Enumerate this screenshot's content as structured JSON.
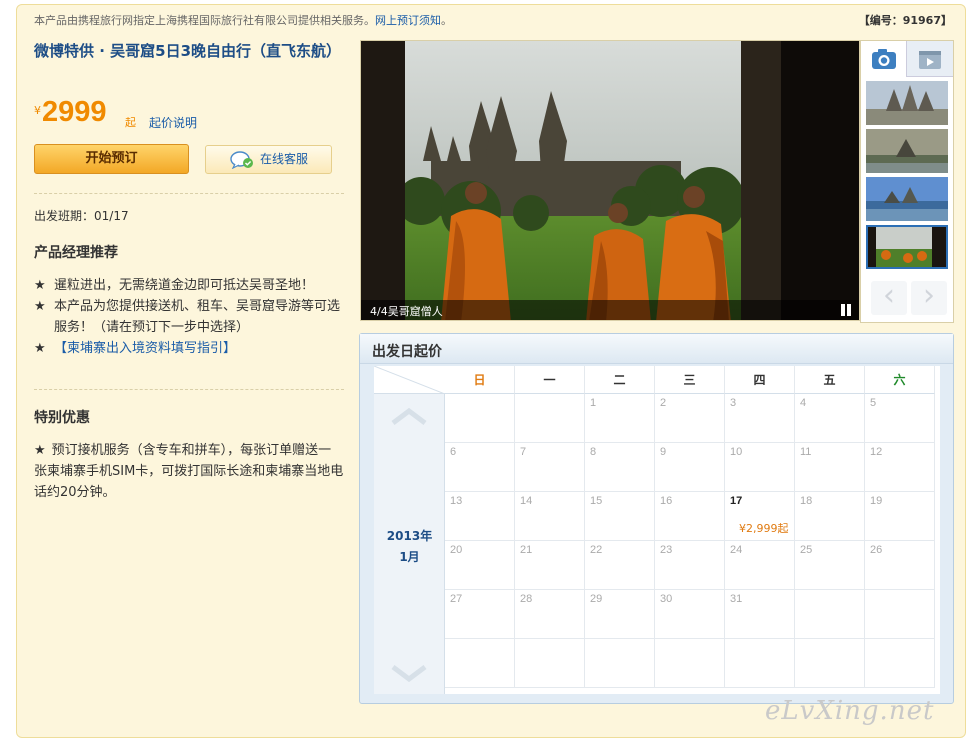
{
  "header": {
    "notice": "本产品由携程旅行网指定上海携程国际旅行社有限公司提供相关服务。",
    "notice_link": "网上预订须知",
    "notice_end": "。",
    "product_code": "【编号：91967】"
  },
  "product": {
    "title": "微博特供 · 吴哥窟5日3晚自由行（直飞东航）",
    "price_currency": "¥",
    "price": "2999",
    "price_unit": "起",
    "price_explain": "起价说明"
  },
  "buttons": {
    "book": "开始预订",
    "service": "在线客服"
  },
  "depart": "出发班期：01/17",
  "recommend": {
    "title": "产品经理推荐",
    "items": [
      "暹粒进出，无需绕道金边即可抵达吴哥圣地！",
      "本产品为您提供接送机、租车、吴哥窟导游等可选服务！（请在预订下一步中选择）"
    ],
    "link": "【柬埔寨出入境资料填写指引】",
    "star": "★"
  },
  "special": {
    "title": "特别优惠",
    "text": "预订接机服务（含专车和拼车），每张订单赠送一张柬埔寨手机SIM卡，可拨打国际长途和柬埔寨当地电话约20分钟。"
  },
  "photo": {
    "caption": "4/4吴哥窟僧人",
    "tabs": [
      "camera-icon",
      "video-icon"
    ],
    "thumbnail_count": 4,
    "active_thumbnail": 4
  },
  "calendar": {
    "title": "出发日起价",
    "year_month": [
      "2013年",
      "1月"
    ],
    "weekdays": [
      "日",
      "一",
      "二",
      "三",
      "四",
      "五",
      "六"
    ],
    "weeks": [
      [
        "",
        "",
        "1",
        "2",
        "3",
        "4",
        "5"
      ],
      [
        "6",
        "7",
        "8",
        "9",
        "10",
        "11",
        "12"
      ],
      [
        "13",
        "14",
        "15",
        "16",
        "17",
        "18",
        "19"
      ],
      [
        "20",
        "21",
        "22",
        "23",
        "24",
        "25",
        "26"
      ],
      [
        "27",
        "28",
        "29",
        "30",
        "31",
        "",
        ""
      ],
      [
        "",
        "",
        "",
        "",
        "",
        "",
        ""
      ]
    ],
    "available": [
      {
        "day": "17",
        "price": "¥2,999起"
      }
    ],
    "colors": {
      "sunday": "#e07b12",
      "saturday": "#1f8a2a",
      "price": "#e07b12"
    }
  },
  "watermark": "eLvXing.net",
  "colors": {
    "accent_orange": "#f08a00",
    "link_blue": "#1a5ca8",
    "title_blue": "#1d4d86"
  }
}
